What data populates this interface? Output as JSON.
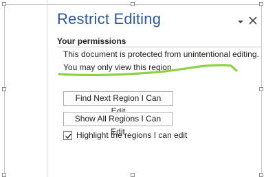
{
  "pane": {
    "title": "Restrict Editing",
    "options_icon": "chevron-down-icon",
    "close_icon": "close-icon"
  },
  "permissions": {
    "heading": "Your permissions",
    "line1": "This document is protected from unintentional editing.",
    "line2": "You may only view this region."
  },
  "buttons": {
    "find_next": "Find Next Region I Can Edit",
    "show_all": "Show All Regions I Can Edit"
  },
  "highlight_option": {
    "label": "Highlight the regions I can edit",
    "checked": true
  },
  "colors": {
    "title": "#2b579a",
    "annotation": "#8ed145"
  }
}
